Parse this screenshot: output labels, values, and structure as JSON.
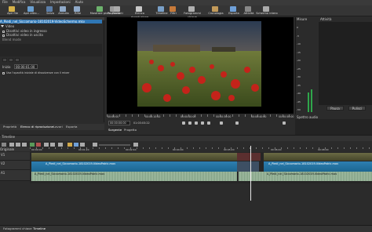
{
  "menu": [
    "File",
    "Modifica",
    "Visualizza",
    "Impostazioni",
    "Aiuto"
  ],
  "toolbar": [
    "Apri file",
    "Apri altro...",
    "Salva",
    "Annulla",
    "Rifai",
    "Mostrare picco",
    "Proprietà",
    "Recenti",
    "Elenco riproduzione",
    "Timeline",
    "Filtri",
    "Fotogrammi chiave",
    "Cronologia",
    "Esporta",
    "Attività",
    "Schermo intero"
  ],
  "playlist": {
    "title": "A_Piedi_nel_Siccomario-18102019-VideoSchermo.mkv",
    "group": "Video",
    "options": [
      "Disattivi video in ingresso",
      "Disattivi video in uscita"
    ],
    "blend_label": "Blend mode",
    "fields": [
      {
        "label": "Inizio",
        "value": "00:00:01:00"
      },
      {
        "label": "Durata",
        "value": "00:00:00:00"
      }
    ],
    "note": "Usa l'opacità iniziale di dissolvenze con il mixer"
  },
  "left_tabs": [
    "Proprietà",
    "Elenco di riproduzione",
    "Lavori",
    "Esporta"
  ],
  "player": {
    "tc_current": "00:00:00:00",
    "tc_total": "01:03:03:22",
    "ruler": [
      "00:00:00",
      "00:00:10:00",
      "00:00:20:00",
      "00:00:30:00",
      "00:00:40:00",
      "00:00:50:00"
    ],
    "tabs": [
      "Sorgente",
      "Progetto"
    ]
  },
  "right": {
    "vu_title": "Misure",
    "vu_scale": [
      "0",
      "-5",
      "-10",
      "-15",
      "-20",
      "-25",
      "-30",
      "-35",
      "-40",
      "-45",
      "-50"
    ],
    "recent_title": "Attività",
    "pause": "Pausa",
    "clear": "Pulisci",
    "spectrum_title": "Spettro audio"
  },
  "timeline": {
    "title": "Timeline",
    "tracks": [
      "Originale",
      "V1",
      "V2",
      "A1"
    ],
    "ruler": [
      "00:00:00",
      "00:01:20",
      "00:02:40",
      "00:04:00",
      "00:05:20",
      "00:06:40",
      "00:08:00"
    ],
    "clips": [
      "A_Piedi_nel_Siccomario-18102019-VideoPatric.mov",
      "A_Piedi_nel_Siccomario-18102019-VideoPatric.mov",
      "A_Piedi_nel_Siccomario-18102019-VideoPatric.mov",
      "A_Piedi_nel_Siccomario-18102019-VideoPatric.mov"
    ]
  },
  "bottom_tabs": [
    "Fotogrammi chiave",
    "Timeline"
  ],
  "colors": {
    "accent": "#2f77b5",
    "clip_blue": "#2278a8",
    "playhead": "#e8e8e8",
    "vu_green": "#2fa64a"
  }
}
